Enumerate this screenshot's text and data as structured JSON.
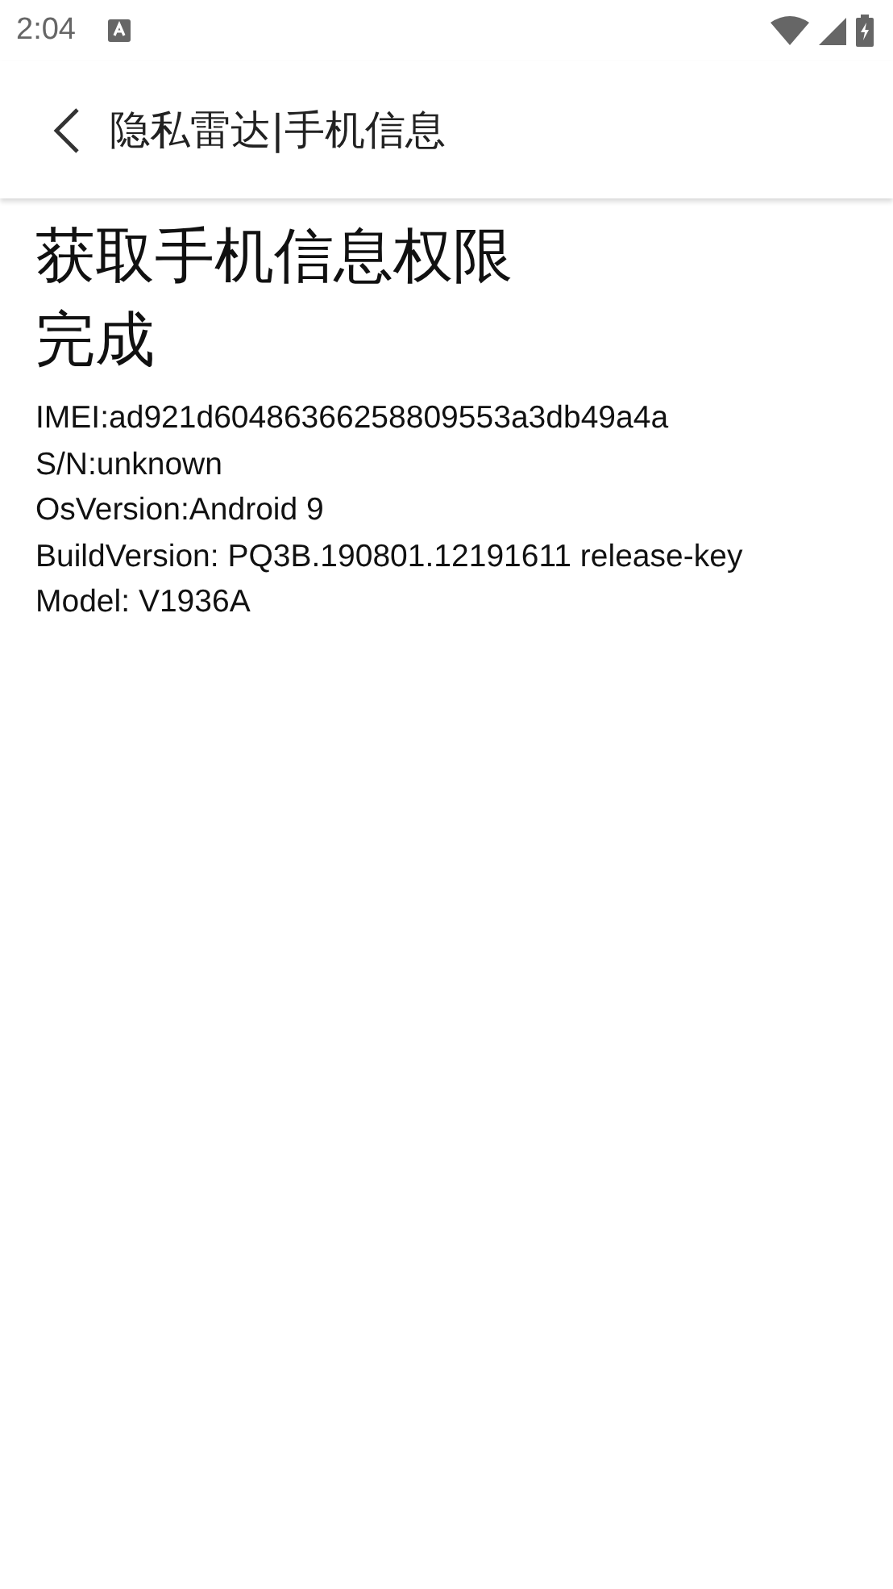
{
  "status_bar": {
    "time": "2:04"
  },
  "app_bar": {
    "title": "隐私雷达|手机信息"
  },
  "heading_lines": [
    "获取手机信息权限",
    "完成"
  ],
  "info_lines": [
    "IMEI:ad921d60486366258809553a3db49a4a",
    "S/N:unknown",
    "OsVersion:Android 9",
    "BuildVersion: PQ3B.190801.12191611 release-key",
    "Model: V1936A"
  ]
}
